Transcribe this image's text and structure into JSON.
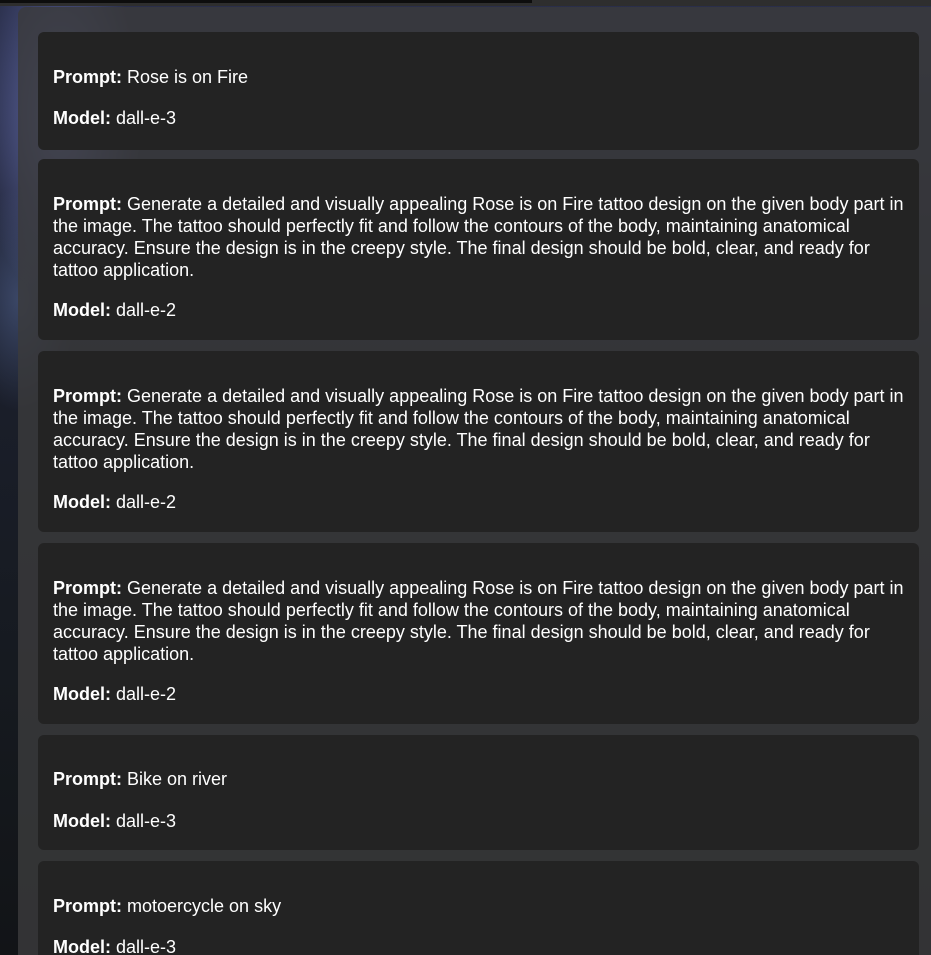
{
  "labels": {
    "prompt": "Prompt:",
    "model": "Model:"
  },
  "history": [
    {
      "prompt": "Rose is on Fire",
      "model": "dall-e-3"
    },
    {
      "prompt": "Generate a detailed and visually appealing Rose is on Fire tattoo design on the given body part in the image. The tattoo should perfectly fit and follow the contours of the body, maintaining anatomical accuracy. Ensure the design is in the creepy style. The final design should be bold, clear, and ready for tattoo application.",
      "model": "dall-e-2"
    },
    {
      "prompt": "Generate a detailed and visually appealing Rose is on Fire tattoo design on the given body part in the image. The tattoo should perfectly fit and follow the contours of the body, maintaining anatomical accuracy. Ensure the design is in the creepy style. The final design should be bold, clear, and ready for tattoo application.",
      "model": "dall-e-2"
    },
    {
      "prompt": "Generate a detailed and visually appealing Rose is on Fire tattoo design on the given body part in the image. The tattoo should perfectly fit and follow the contours of the body, maintaining anatomical accuracy. Ensure the design is in the creepy style. The final design should be bold, clear, and ready for tattoo application.",
      "model": "dall-e-2"
    },
    {
      "prompt": "Bike on river",
      "model": "dall-e-3"
    },
    {
      "prompt": "motoercycle on sky",
      "model": "dall-e-3"
    }
  ],
  "colors": {
    "card_background": "#232323",
    "panel_background": "#3a3a3c",
    "text": "#ffffff"
  }
}
